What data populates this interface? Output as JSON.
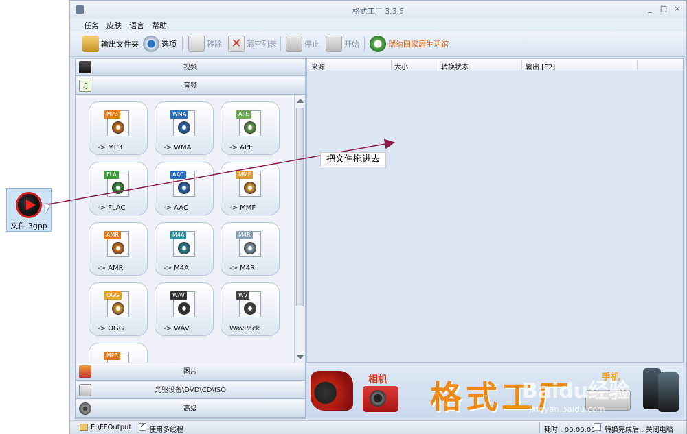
{
  "window": {
    "title": "格式工厂 3.3.5",
    "controls": [
      "_",
      "□",
      "×"
    ]
  },
  "menu": [
    "任务",
    "皮肤",
    "语言",
    "帮助"
  ],
  "toolbar": {
    "output_folder": "输出文件夹",
    "options": "选项",
    "remove": "移除",
    "clear_list": "清空列表",
    "stop": "停止",
    "start": "开始",
    "promo": "瑞纳田家居生活馆"
  },
  "categories": {
    "video": "视频",
    "audio": "音频",
    "image": "图片",
    "optical": "光驱设备\\DVD\\CD\\ISO",
    "advanced": "高级"
  },
  "audio_formats": [
    {
      "tag": "MP3",
      "caption": "-> MP3",
      "color": "#e07a1a"
    },
    {
      "tag": "WMA",
      "caption": "-> WMA",
      "color": "#2a6fc0"
    },
    {
      "tag": "APE",
      "caption": "-> APE",
      "color": "#6aa84f"
    },
    {
      "tag": "FLA",
      "caption": "-> FLAC",
      "color": "#3c9a3c"
    },
    {
      "tag": "AAC",
      "caption": "-> AAC",
      "color": "#2a6fc0"
    },
    {
      "tag": "MMF",
      "caption": "-> MMF",
      "color": "#e0a030"
    },
    {
      "tag": "AMR",
      "caption": "-> AMR",
      "color": "#e07a1a"
    },
    {
      "tag": "M4A",
      "caption": "-> M4A",
      "color": "#2a8a9a"
    },
    {
      "tag": "M4R",
      "caption": "-> M4R",
      "color": "#8aa0b0"
    },
    {
      "tag": "OGG",
      "caption": "-> OGG",
      "color": "#e0a030"
    },
    {
      "tag": "WAV",
      "caption": "-> WAV",
      "color": "#333333"
    },
    {
      "tag": "WV",
      "caption": "WavPack",
      "color": "#444444"
    },
    {
      "tag": "MP3",
      "caption": "",
      "color": "#e07a1a"
    }
  ],
  "list_columns": [
    "来源",
    "大小",
    "转换状态",
    "输出 [F2]"
  ],
  "banner": {
    "camera_label": "相机",
    "brand": "格式工厂",
    "phone_label": "手机"
  },
  "status": {
    "output_path": "E:\\FFOutput",
    "multithread": "使用多线程",
    "elapsed": "耗时 : 00:00:00",
    "after_done": "转换完成后 : 关闭电脑"
  },
  "desktop_file": {
    "name": "文件.3gpp"
  },
  "annotation": "把文件拖进去",
  "watermark": {
    "logo": "Baidu经验",
    "url": "jingyan.baidu.com"
  },
  "colors": {
    "accent": "#f08a17",
    "drag_arrow": "#8b1a4a"
  }
}
